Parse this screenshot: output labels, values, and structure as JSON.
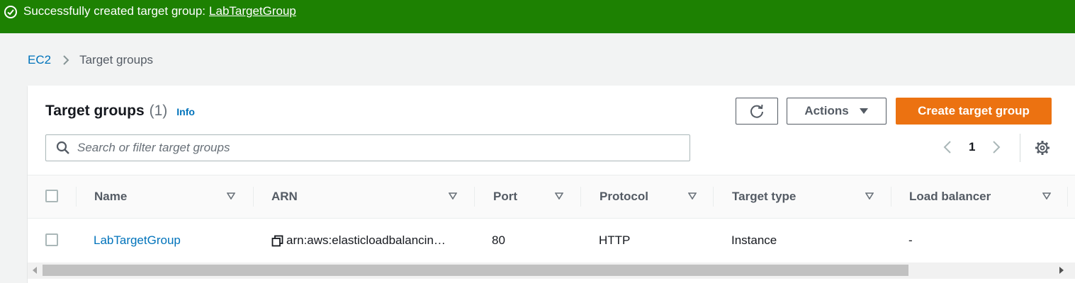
{
  "flash": {
    "message": "Successfully created target group:",
    "link": "LabTargetGroup",
    "color": "#1d8102"
  },
  "breadcrumb": {
    "root": "EC2",
    "current": "Target groups"
  },
  "panel": {
    "title": "Target groups",
    "count": "(1)",
    "info": "Info",
    "actions_label": "Actions",
    "create_label": "Create target group",
    "search_placeholder": "Search or filter target groups",
    "search_value": "",
    "page_number": "1"
  },
  "table": {
    "columns": [
      "Name",
      "ARN",
      "Port",
      "Protocol",
      "Target type",
      "Load balancer"
    ],
    "rows": [
      {
        "name": "LabTargetGroup",
        "arn": "arn:aws:elasticloadbalancin…",
        "port": "80",
        "protocol": "HTTP",
        "target_type": "Instance",
        "load_balancer": "-"
      }
    ]
  },
  "colors": {
    "accent": "#ec7211",
    "link": "#0073bb",
    "success": "#1d8102"
  },
  "icons": [
    "check-circle-icon",
    "chevron-right-icon",
    "refresh-icon",
    "caret-down-icon",
    "search-icon",
    "chevron-left-icon",
    "gear-icon",
    "sort-icon",
    "copy-icon"
  ]
}
